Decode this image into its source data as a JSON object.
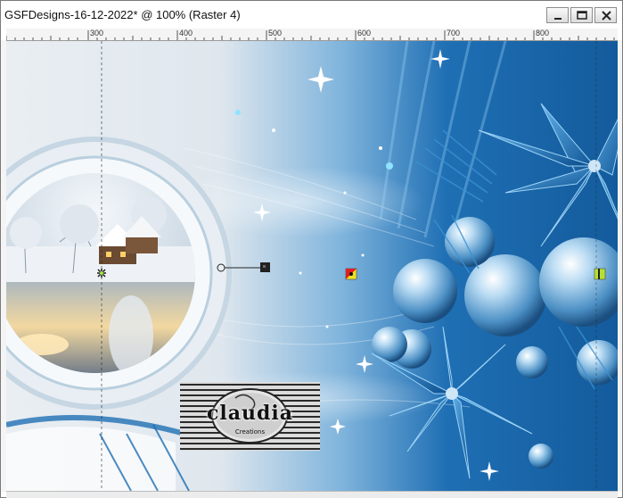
{
  "window": {
    "title": "GSFDesigns-16-12-2022* @ 100% (Raster 4)",
    "buttons": {
      "minimize": "minimize",
      "restore": "restore",
      "close": "close"
    }
  },
  "ruler": {
    "labels": [
      "300",
      "400",
      "500",
      "600",
      "700",
      "800"
    ]
  },
  "watermark": {
    "text": "claudia",
    "subtext": "Creations"
  },
  "icons": {
    "snowflake_marker": "asterisk-icon",
    "anchor_handle": "rotation-handle-icon",
    "flag_marker": "node-marker-icon",
    "right_marker": "node-marker-icon"
  },
  "colors": {
    "sky": "#2a78b8",
    "deep_blue": "#0e4f8c",
    "frame_white": "#eef3f7",
    "flag_red": "#e02020",
    "flag_yellow": "#f0e020",
    "marker_green": "#b6e030"
  }
}
